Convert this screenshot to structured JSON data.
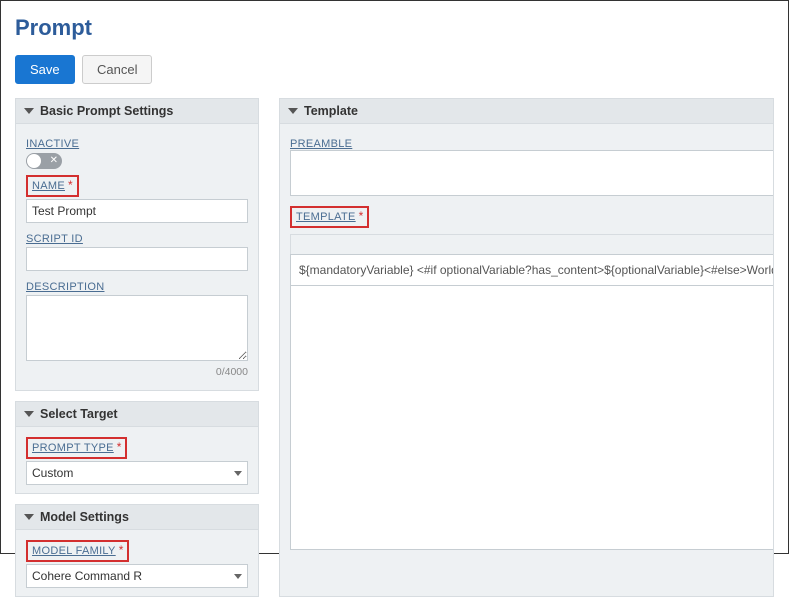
{
  "header": {
    "title": "Prompt"
  },
  "actions": {
    "save": "Save",
    "cancel": "Cancel"
  },
  "section_basic": {
    "title": "Basic Prompt Settings",
    "inactive_label": "INACTIVE",
    "inactive_on": false,
    "name_label": "NAME",
    "name_value": "Test Prompt",
    "scriptid_label": "SCRIPT ID",
    "scriptid_value": "",
    "description_label": "DESCRIPTION",
    "description_value": "",
    "description_counter": "0/4000"
  },
  "section_target": {
    "title": "Select Target",
    "type_label": "PROMPT TYPE",
    "type_value": "Custom"
  },
  "section_model": {
    "title": "Model Settings",
    "family_label": "MODEL FAMILY",
    "family_value": "Cohere Command R"
  },
  "section_template": {
    "title": "Template",
    "preamble_label": "PREAMBLE",
    "preamble_value": "",
    "template_label": "TEMPLATE",
    "template_value": "${mandatoryVariable} <#if optionalVariable?has_content>${optionalVariable}<#else>World</#i"
  },
  "required_marker": "*"
}
